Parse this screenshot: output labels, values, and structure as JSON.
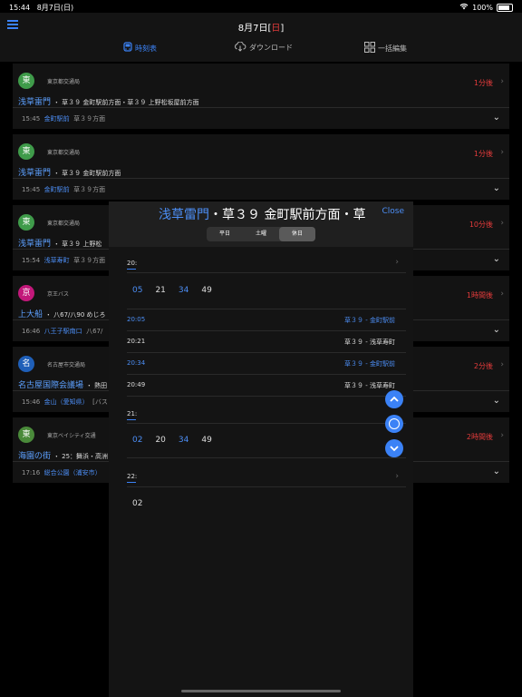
{
  "status_bar": {
    "time": "15:44",
    "date": "8月7日(日)",
    "battery": "100%"
  },
  "header": {
    "title_main": "8月7日[",
    "title_day": "日",
    "title_end": "]",
    "tabs": [
      {
        "label": "時刻表",
        "icon": "bus-icon",
        "active": true
      },
      {
        "label": "ダウンロード",
        "icon": "cloud-download-icon",
        "active": false
      },
      {
        "label": "一括編集",
        "icon": "grid-icon",
        "active": false
      }
    ]
  },
  "cards": [
    {
      "badge": "東",
      "badge_color": "#3f9b4a",
      "operator": "東京都交通局",
      "stop": "浅草雷門",
      "route": "・ 草３９ 金町駅前方面・草３９ 上野松坂屋前方面",
      "eta": "1分後",
      "meta_time": "15:45",
      "meta_stop": "金町駅前",
      "meta_dir": "草３９方面"
    },
    {
      "badge": "東",
      "badge_color": "#3f9b4a",
      "operator": "東京都交通局",
      "stop": "浅草雷門",
      "route": "・ 草３９ 金町駅前方面",
      "eta": "1分後",
      "meta_time": "15:45",
      "meta_stop": "金町駅前",
      "meta_dir": "草３９方面"
    },
    {
      "badge": "東",
      "badge_color": "#3f9b4a",
      "operator": "東京都交通局",
      "stop": "浅草雷門",
      "route": "・ 草３９ 上野松",
      "eta": "10分後",
      "meta_time": "15:54",
      "meta_stop": "浅草寿町",
      "meta_dir": "草３９方面"
    },
    {
      "badge": "京",
      "badge_color": "#c2187a",
      "operator": "京王バス",
      "stop": "上大船",
      "route": "・ 八67/八90 めじろ",
      "eta": "1時間後",
      "meta_time": "16:46",
      "meta_stop": "八王子駅南口",
      "meta_dir": "八67/"
    },
    {
      "badge": "名",
      "badge_color": "#1f5fb8",
      "operator": "名古屋市交通局",
      "stop": "名古屋国際会議場",
      "route": "・ 熱田",
      "eta": "2分後",
      "meta_time": "15:46",
      "meta_stop": "金山（愛知県）",
      "meta_dir": "[バス"
    },
    {
      "badge": "東",
      "badge_color": "#4a8a3a",
      "operator": "東京ベイシティ交通",
      "stop": "海園の街",
      "route": "・ 25：舞浜・高洲",
      "eta": "2時間後",
      "meta_time": "17:16",
      "meta_stop": "総合公園（浦安市）",
      "meta_dir": ""
    }
  ],
  "modal": {
    "title_stop": "浅草雷門",
    "title_rest": "・草３９ 金町駅前方面・草",
    "close_label": "Close",
    "segments": [
      {
        "label": "平日",
        "selected": false
      },
      {
        "label": "土曜",
        "selected": false
      },
      {
        "label": "休日",
        "selected": true
      }
    ],
    "hours": [
      {
        "label": "20:",
        "minutes": [
          {
            "v": "05",
            "blue": true
          },
          {
            "v": "21",
            "blue": false
          },
          {
            "v": "34",
            "blue": true
          },
          {
            "v": "49",
            "blue": false
          }
        ]
      },
      {
        "label": "21:",
        "minutes": [
          {
            "v": "02",
            "blue": true
          },
          {
            "v": "20",
            "blue": false
          },
          {
            "v": "34",
            "blue": true
          },
          {
            "v": "49",
            "blue": false
          }
        ]
      },
      {
        "label": "22:",
        "minutes": [
          {
            "v": "02",
            "blue": false
          }
        ]
      }
    ],
    "trips": [
      {
        "time": "20:05",
        "dest": "草３９ - 金町駅前",
        "blue": true
      },
      {
        "time": "20:21",
        "dest": "草３９ - 浅草寿町",
        "blue": false
      },
      {
        "time": "20:34",
        "dest": "草３９ - 金町駅前",
        "blue": true
      },
      {
        "time": "20:49",
        "dest": "草３９ - 浅草寿町",
        "blue": false
      }
    ]
  },
  "colors": {
    "accent": "#3b82f6",
    "alert": "#e23b3b"
  }
}
